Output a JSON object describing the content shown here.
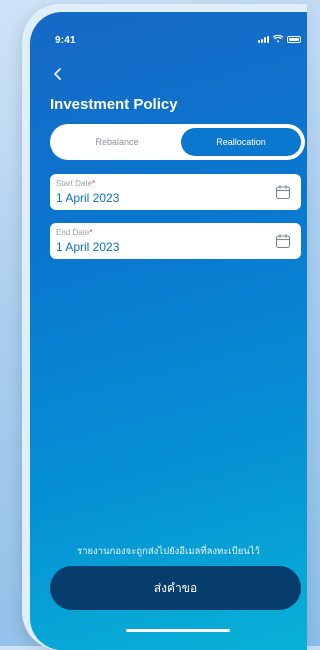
{
  "status_bar": {
    "time": "9:41"
  },
  "header": {
    "back_icon": "chevron-left-icon",
    "title": "Investment Policy"
  },
  "segmented_control": {
    "options": [
      {
        "label": "Rebalance",
        "selected": false
      },
      {
        "label": "Reallocation",
        "selected": true
      }
    ]
  },
  "form": {
    "start_date": {
      "label": "Start Date",
      "required_mark": "*",
      "value": "1 April 2023",
      "icon": "calendar-icon"
    },
    "end_date": {
      "label": "End Date",
      "required_mark": "*",
      "value": "1 April 2023",
      "icon": "calendar-icon"
    }
  },
  "footer": {
    "note": "รายงานกองจะถูกส่งไปยังอีเมลที่ลงทะเบียนไว้",
    "submit_label": "ส่งคำขอ"
  },
  "colors": {
    "primary": "#0b78d0",
    "dark_button": "#073d6c",
    "required": "#e5322d",
    "value_text": "#0b6fc4"
  }
}
